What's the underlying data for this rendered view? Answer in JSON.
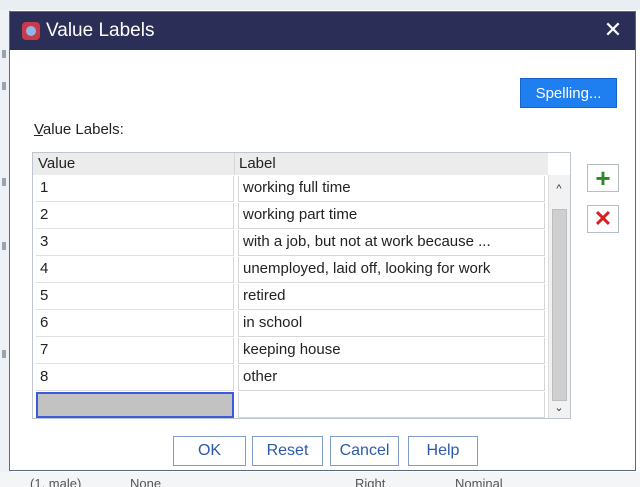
{
  "dialog": {
    "title": "Value Labels",
    "close_label": "✕",
    "spelling_button": "Spelling...",
    "section_label_first": "V",
    "section_label_rest": "alue Labels:",
    "columns": {
      "value": "Value",
      "label": "Label"
    },
    "rows": [
      {
        "value": "1",
        "label": "working full time"
      },
      {
        "value": "2",
        "label": "working part time"
      },
      {
        "value": "3",
        "label": "with a job, but not at work because ..."
      },
      {
        "value": "4",
        "label": "unemployed, laid off, looking for work"
      },
      {
        "value": "5",
        "label": "retired"
      },
      {
        "value": "6",
        "label": "in school"
      },
      {
        "value": "7",
        "label": "keeping house"
      },
      {
        "value": "8",
        "label": "other"
      }
    ],
    "new_row": {
      "value": "",
      "label": ""
    },
    "scroll_up_glyph": "^",
    "scroll_down_glyph": "⌄",
    "add_glyph": "+",
    "delete_glyph": "✕",
    "buttons": {
      "ok": "OK",
      "reset": "Reset",
      "cancel": "Cancel",
      "help": "Help"
    }
  },
  "background": {
    "bottom_left": "(1, male)",
    "bottom_mid": "None",
    "bottom_right": "Right",
    "bottom_far": "Nominal"
  },
  "colors": {
    "titlebar": "#2b2e56",
    "accent": "#1f7ef0",
    "add": "#2a8a2a",
    "delete": "#d71f1f"
  }
}
